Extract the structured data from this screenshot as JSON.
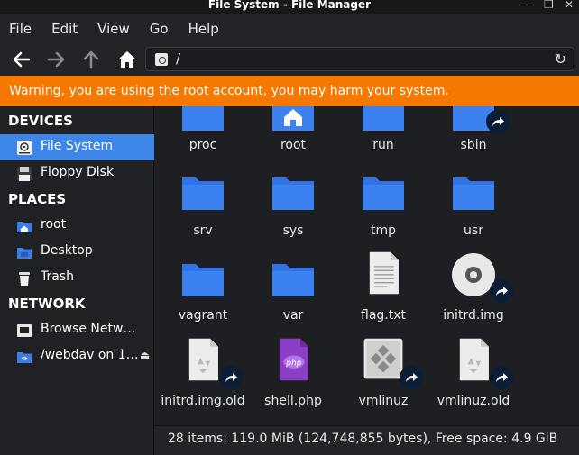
{
  "window": {
    "title": "File System - File Manager",
    "controls": [
      "—",
      "❐",
      "✕"
    ]
  },
  "menu": [
    "File",
    "Edit",
    "View",
    "Go",
    "Help"
  ],
  "location": {
    "path": "/"
  },
  "warning": "Warning, you are using the root account, you may harm your system.",
  "sidebar": {
    "devices_header": "DEVICES",
    "devices": [
      {
        "label": "File System",
        "icon": "drive-icon",
        "active": true
      },
      {
        "label": "Floppy Disk",
        "icon": "floppy-icon"
      }
    ],
    "places_header": "PLACES",
    "places": [
      {
        "label": "root",
        "icon": "home-folder-icon"
      },
      {
        "label": "Desktop",
        "icon": "desktop-folder-icon"
      },
      {
        "label": "Trash",
        "icon": "trash-icon"
      }
    ],
    "network_header": "NETWORK",
    "network": [
      {
        "label": "Browse Netw…",
        "icon": "network-icon"
      },
      {
        "label": "/webdav on 1…",
        "icon": "webdav-icon",
        "eject": "⏏"
      }
    ]
  },
  "files": [
    {
      "name": "proc",
      "icon": "folder-icon"
    },
    {
      "name": "root",
      "icon": "home-folder-icon"
    },
    {
      "name": "run",
      "icon": "folder-icon"
    },
    {
      "name": "sbin",
      "icon": "folder-icon",
      "link": true
    },
    {
      "name": "srv",
      "icon": "folder-icon"
    },
    {
      "name": "sys",
      "icon": "folder-icon"
    },
    {
      "name": "tmp",
      "icon": "folder-icon"
    },
    {
      "name": "usr",
      "icon": "folder-icon"
    },
    {
      "name": "vagrant",
      "icon": "folder-icon"
    },
    {
      "name": "var",
      "icon": "folder-icon"
    },
    {
      "name": "flag.txt",
      "icon": "text-file-icon"
    },
    {
      "name": "initrd.img",
      "icon": "disc-image-icon",
      "link": true
    },
    {
      "name": "initrd.img.old",
      "icon": "archive-file-icon",
      "link": true
    },
    {
      "name": "shell.php",
      "icon": "php-file-icon",
      "badge_text": "php"
    },
    {
      "name": "vmlinuz",
      "icon": "executable-icon",
      "link": true
    },
    {
      "name": "vmlinuz.old",
      "icon": "archive-file-icon",
      "link": true
    }
  ],
  "status": "28 items: 119.0 MiB (124,748,855 bytes), Free space: 4.9 GiB",
  "colors": {
    "accent": "#3d86e8",
    "warning": "#f57900",
    "folder": "#2f73e6"
  }
}
